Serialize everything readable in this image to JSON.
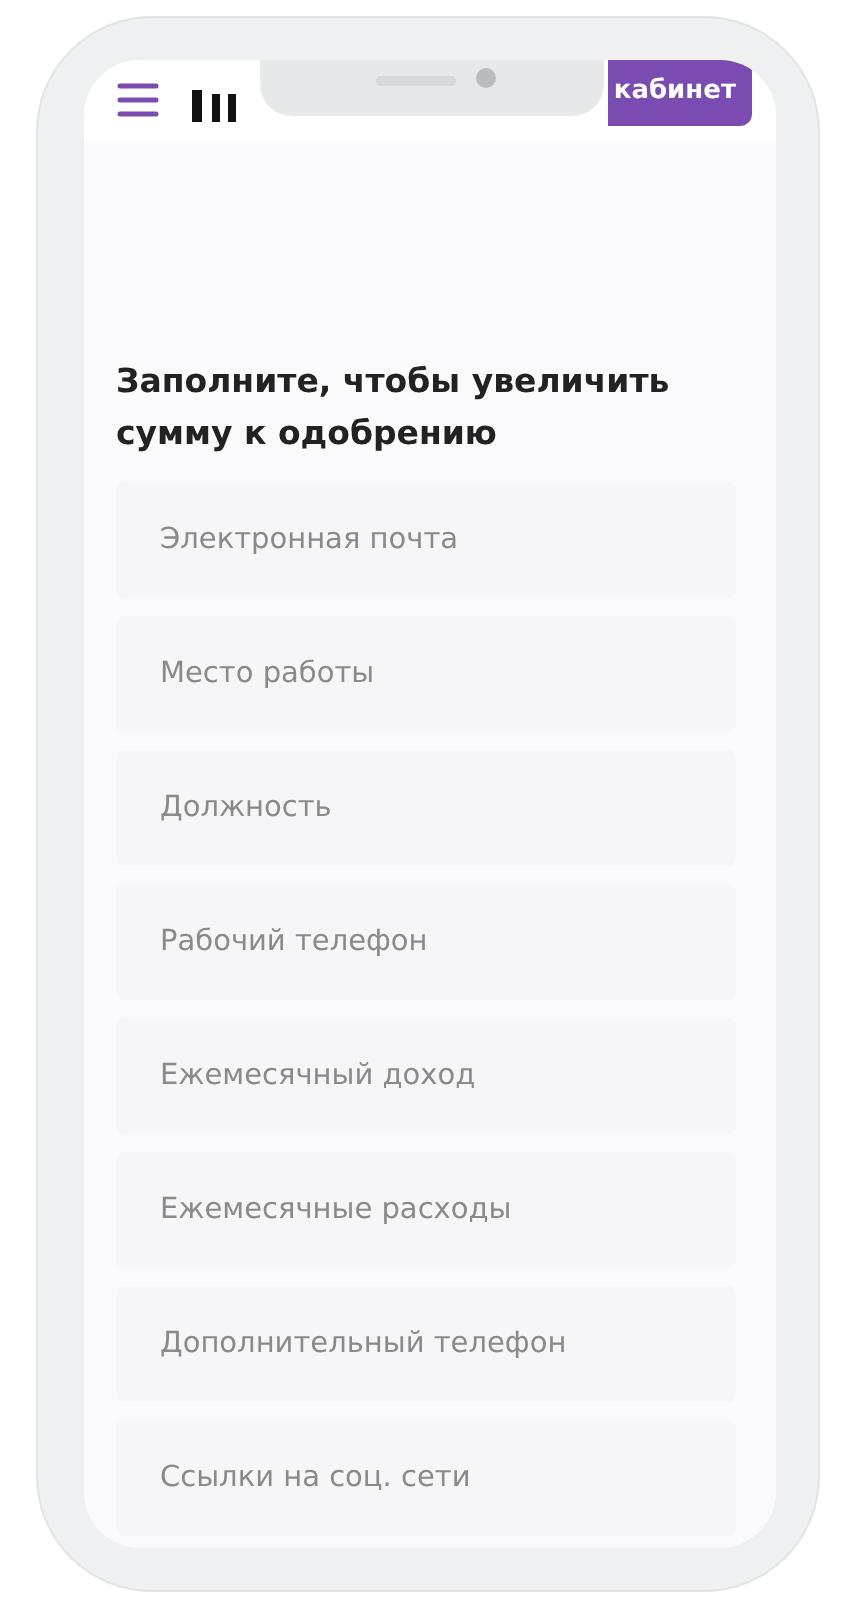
{
  "header": {
    "cabinet_button": "кабинет"
  },
  "form": {
    "title": "Заполните, чтобы увеличить сумму к одобрению",
    "fields": [
      {
        "placeholder": "Электронная почта"
      },
      {
        "placeholder": "Место работы"
      },
      {
        "placeholder": "Должность"
      },
      {
        "placeholder": "Рабочий телефон"
      },
      {
        "placeholder": "Ежемесячный доход"
      },
      {
        "placeholder": "Ежемесячные расходы"
      },
      {
        "placeholder": "Дополнительный телефон"
      },
      {
        "placeholder": "Ссылки на соц. сети"
      }
    ]
  }
}
